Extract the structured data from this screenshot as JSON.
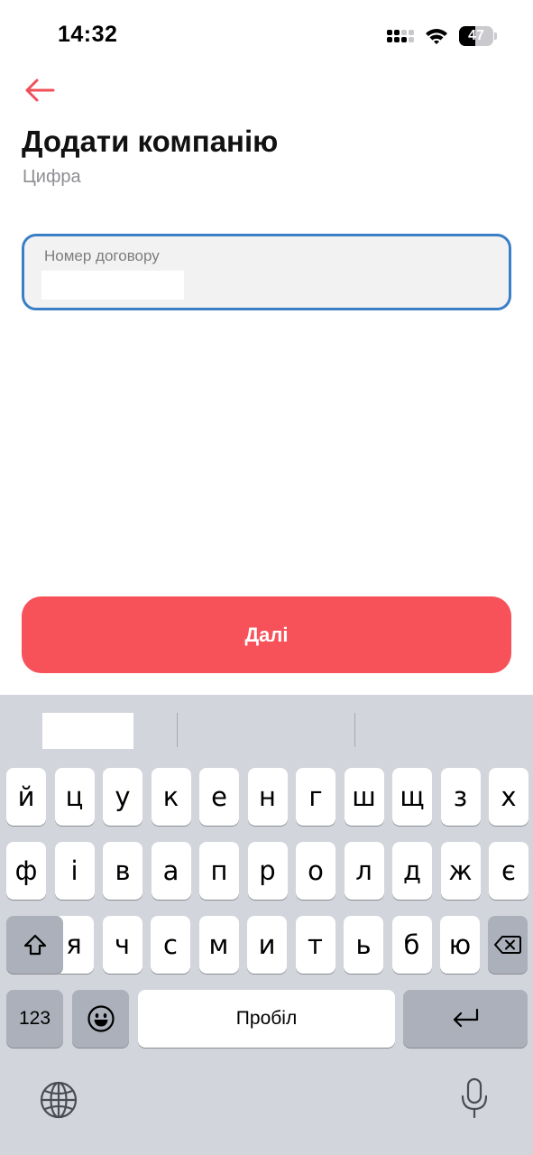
{
  "status_bar": {
    "time": "14:32",
    "battery": "47",
    "battery_level": 0.47
  },
  "header": {
    "title": "Додати компанію",
    "subtitle": "Цифра",
    "back_icon": "arrow-left-icon",
    "accent": "#f0505a"
  },
  "form": {
    "contract_field": {
      "label": "Номер договору",
      "value": "",
      "focus_color": "#3a7fc6"
    }
  },
  "actions": {
    "next_label": "Далі",
    "next_color": "#f75159"
  },
  "keyboard": {
    "row1": [
      "й",
      "ц",
      "у",
      "к",
      "е",
      "н",
      "г",
      "ш",
      "щ",
      "з",
      "х"
    ],
    "row2": [
      "ф",
      "і",
      "в",
      "а",
      "п",
      "р",
      "о",
      "л",
      "д",
      "ж",
      "є"
    ],
    "row3": [
      "я",
      "ч",
      "с",
      "м",
      "и",
      "т",
      "ь",
      "б",
      "ю"
    ],
    "numbers_label": "123",
    "space_label": "Пробіл",
    "icons": {
      "shift": "shift-icon",
      "backspace": "backspace-icon",
      "emoji": "emoji-icon",
      "return": "return-icon",
      "globe": "globe-icon",
      "mic": "microphone-icon"
    }
  }
}
